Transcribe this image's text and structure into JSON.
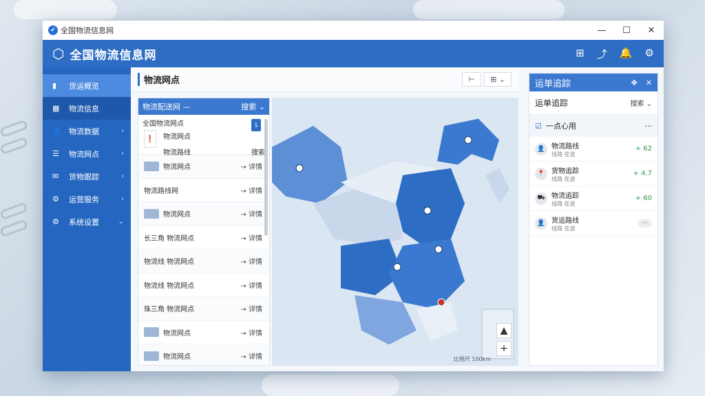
{
  "window": {
    "title": "全国物流信息网"
  },
  "window_controls": {
    "minimize": "—",
    "maximize": "☐",
    "close": "✕"
  },
  "header": {
    "title": "全国物流信息网",
    "tools": [
      "⊞",
      "⤴",
      "🔔",
      "⚙"
    ]
  },
  "sidebar": {
    "items": [
      {
        "label": "货运概览",
        "icon": "▮",
        "chev": ""
      },
      {
        "label": "物流信息",
        "icon": "▦",
        "chev": ""
      },
      {
        "label": "物流数据",
        "icon": "👤",
        "chev": "›"
      },
      {
        "label": "物流网点",
        "icon": "☰",
        "chev": "›"
      },
      {
        "label": "货物跟踪",
        "icon": "✉",
        "chev": "›"
      },
      {
        "label": "运营服务",
        "icon": "⚙",
        "chev": "›"
      },
      {
        "label": "系统设置",
        "icon": "⚙",
        "chev": "⌄"
      }
    ]
  },
  "main": {
    "title": "物流网点",
    "header_buttons": [
      "⊢",
      "⊞ ⌄"
    ]
  },
  "list": {
    "header_left": "物流配送网 —",
    "header_right": "搜索 ⌄",
    "top_card": {
      "line1": "全国物流网点",
      "line2": "物流网点",
      "line3_left": "物流路线",
      "line3_right": "搜索",
      "badge": "⇂"
    },
    "rows": [
      {
        "label": "物流网点",
        "arrow": "→ 详情"
      },
      {
        "label": "物流路线网",
        "arrow": "→ 详情"
      },
      {
        "label": "物流网点",
        "arrow": "→ 详情"
      },
      {
        "label": "长三角 物流网点",
        "arrow": "→ 详情"
      },
      {
        "label": "物流线 物流网点",
        "arrow": "→ 详情"
      },
      {
        "label": "物流线 物流网点",
        "arrow": "→ 详情"
      },
      {
        "label": "珠三角 物流网点",
        "arrow": "→ 详情"
      },
      {
        "label": "物流网点",
        "arrow": "→ 详情"
      },
      {
        "label": "物流网点",
        "arrow": "→ 详情"
      }
    ]
  },
  "map": {
    "zoom_in": "+",
    "zoom_up": "▲",
    "scale": "比例尺 100km"
  },
  "tracking": {
    "title": "运单追踪",
    "subtitle": "运单追踪",
    "select": "搜索 ⌄",
    "quick_label": "一点心用",
    "quick_more": "···",
    "items": [
      {
        "name": "物流路线",
        "sub": "线路 在途",
        "value": "+ 62"
      },
      {
        "name": "货物追踪",
        "sub": "线路 在途",
        "value": "+ 4.7"
      },
      {
        "name": "物流追踪",
        "sub": "线路 在途",
        "value": "+ 60"
      },
      {
        "name": "货运路线",
        "sub": "线路 在途",
        "value": "···"
      }
    ]
  },
  "colors": {
    "primary": "#2d6ec4",
    "sidebar": "#2567c0",
    "accent_green": "#2e9b45"
  }
}
